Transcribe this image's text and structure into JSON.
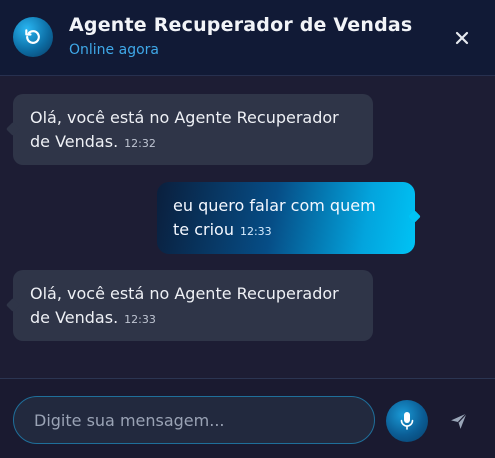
{
  "header": {
    "title": "Agente Recuperador de Vendas",
    "status": "Online agora",
    "avatar_icon": "refresh-arrow-icon",
    "close_icon": "close-icon"
  },
  "messages": [
    {
      "sender": "bot",
      "text": "Olá, você está no Agente Recuperador de Vendas.",
      "time": "12:32"
    },
    {
      "sender": "user",
      "text": "eu quero falar com quem te criou",
      "time": "12:33"
    },
    {
      "sender": "bot",
      "text": "Olá, você está no Agente Recuperador de Vendas.",
      "time": "12:33"
    }
  ],
  "composer": {
    "placeholder": "Digite sua mensagem...",
    "value": "",
    "mic_icon": "microphone-icon",
    "send_icon": "send-icon"
  },
  "colors": {
    "accent": "#00c3f5",
    "status": "#3fa8e8",
    "bot_bubble": "#2f3548",
    "background": "#1d1d34"
  }
}
